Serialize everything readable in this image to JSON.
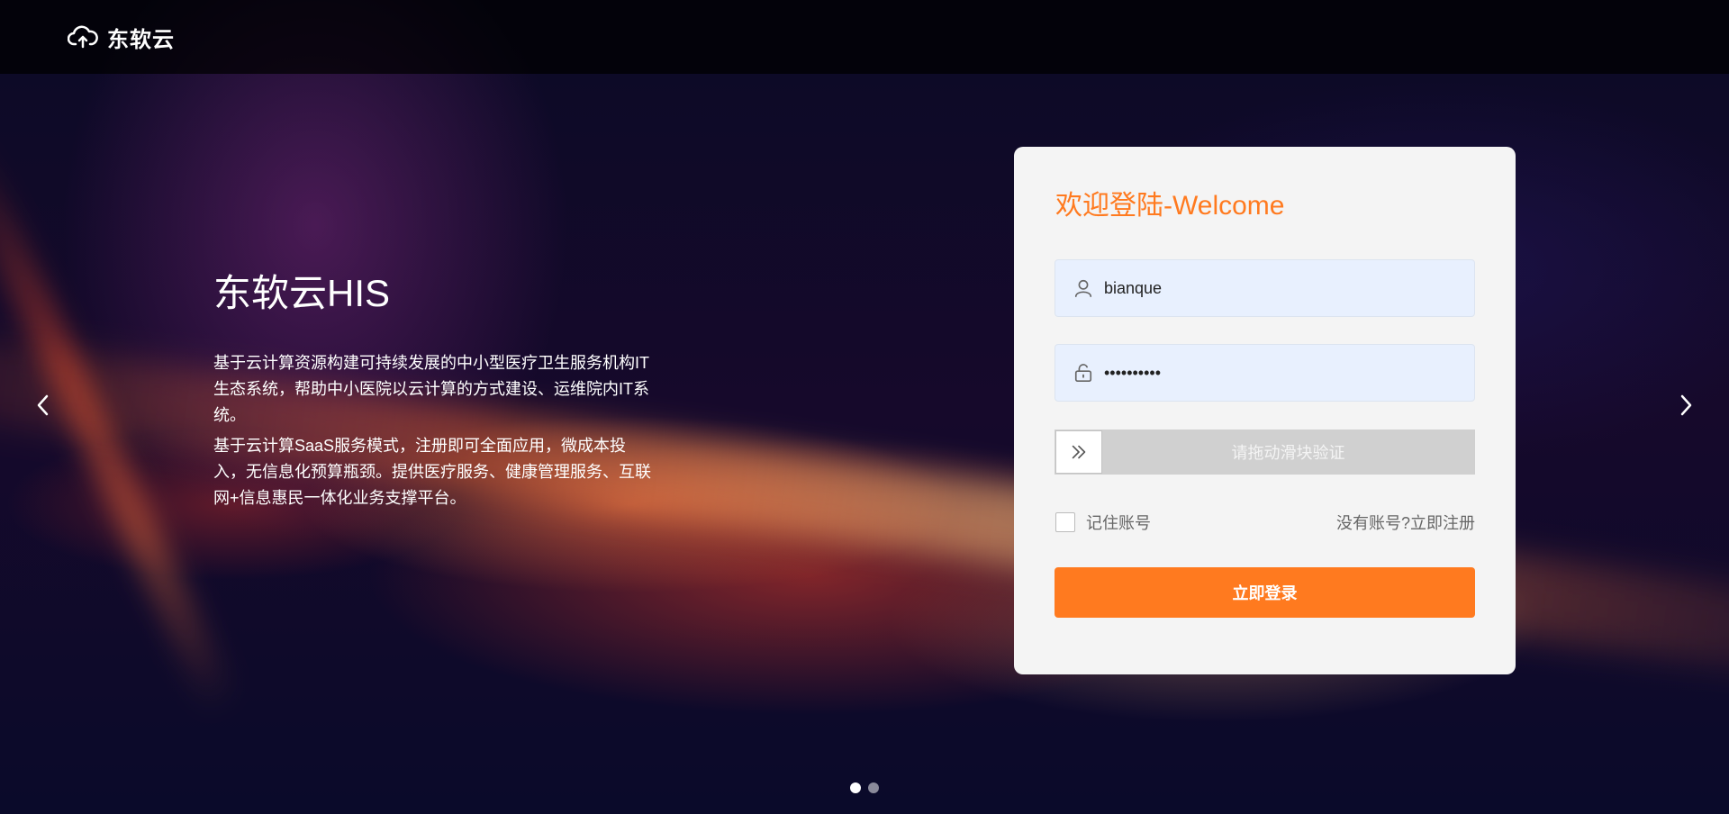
{
  "header": {
    "brand_name": "东软云",
    "logo_icon": "cloud-upload-icon"
  },
  "hero": {
    "title": "东软云HIS",
    "paragraphs": [
      "基于云计算资源构建可持续发展的中小型医疗卫生服务机构IT生态系统，帮助中小医院以云计算的方式建设、运维院内IT系统。",
      "基于云计算SaaS服务模式，注册即可全面应用，微成本投入，无信息化预算瓶颈。提供医疗服务、健康管理服务、互联网+信息惠民一体化业务支撑平台。"
    ]
  },
  "carousel": {
    "prev_icon": "chevron-left-icon",
    "next_icon": "chevron-right-icon",
    "total_slides": 2,
    "active_slide": 1
  },
  "login": {
    "welcome": "欢迎登陆-Welcome",
    "username": {
      "value": "bianque",
      "icon": "user-icon"
    },
    "password": {
      "value": "••••••••••",
      "icon": "lock-icon"
    },
    "slider": {
      "text": "请拖动滑块验证",
      "icon": "double-chevron-right-icon"
    },
    "remember_label": "记住账号",
    "register_prompt": "没有账号?",
    "register_link": "立即注册",
    "submit_label": "立即登录"
  },
  "colors": {
    "accent": "#ff7a1f",
    "card_bg": "#f4f4f4",
    "input_bg": "#e8f0fe"
  }
}
